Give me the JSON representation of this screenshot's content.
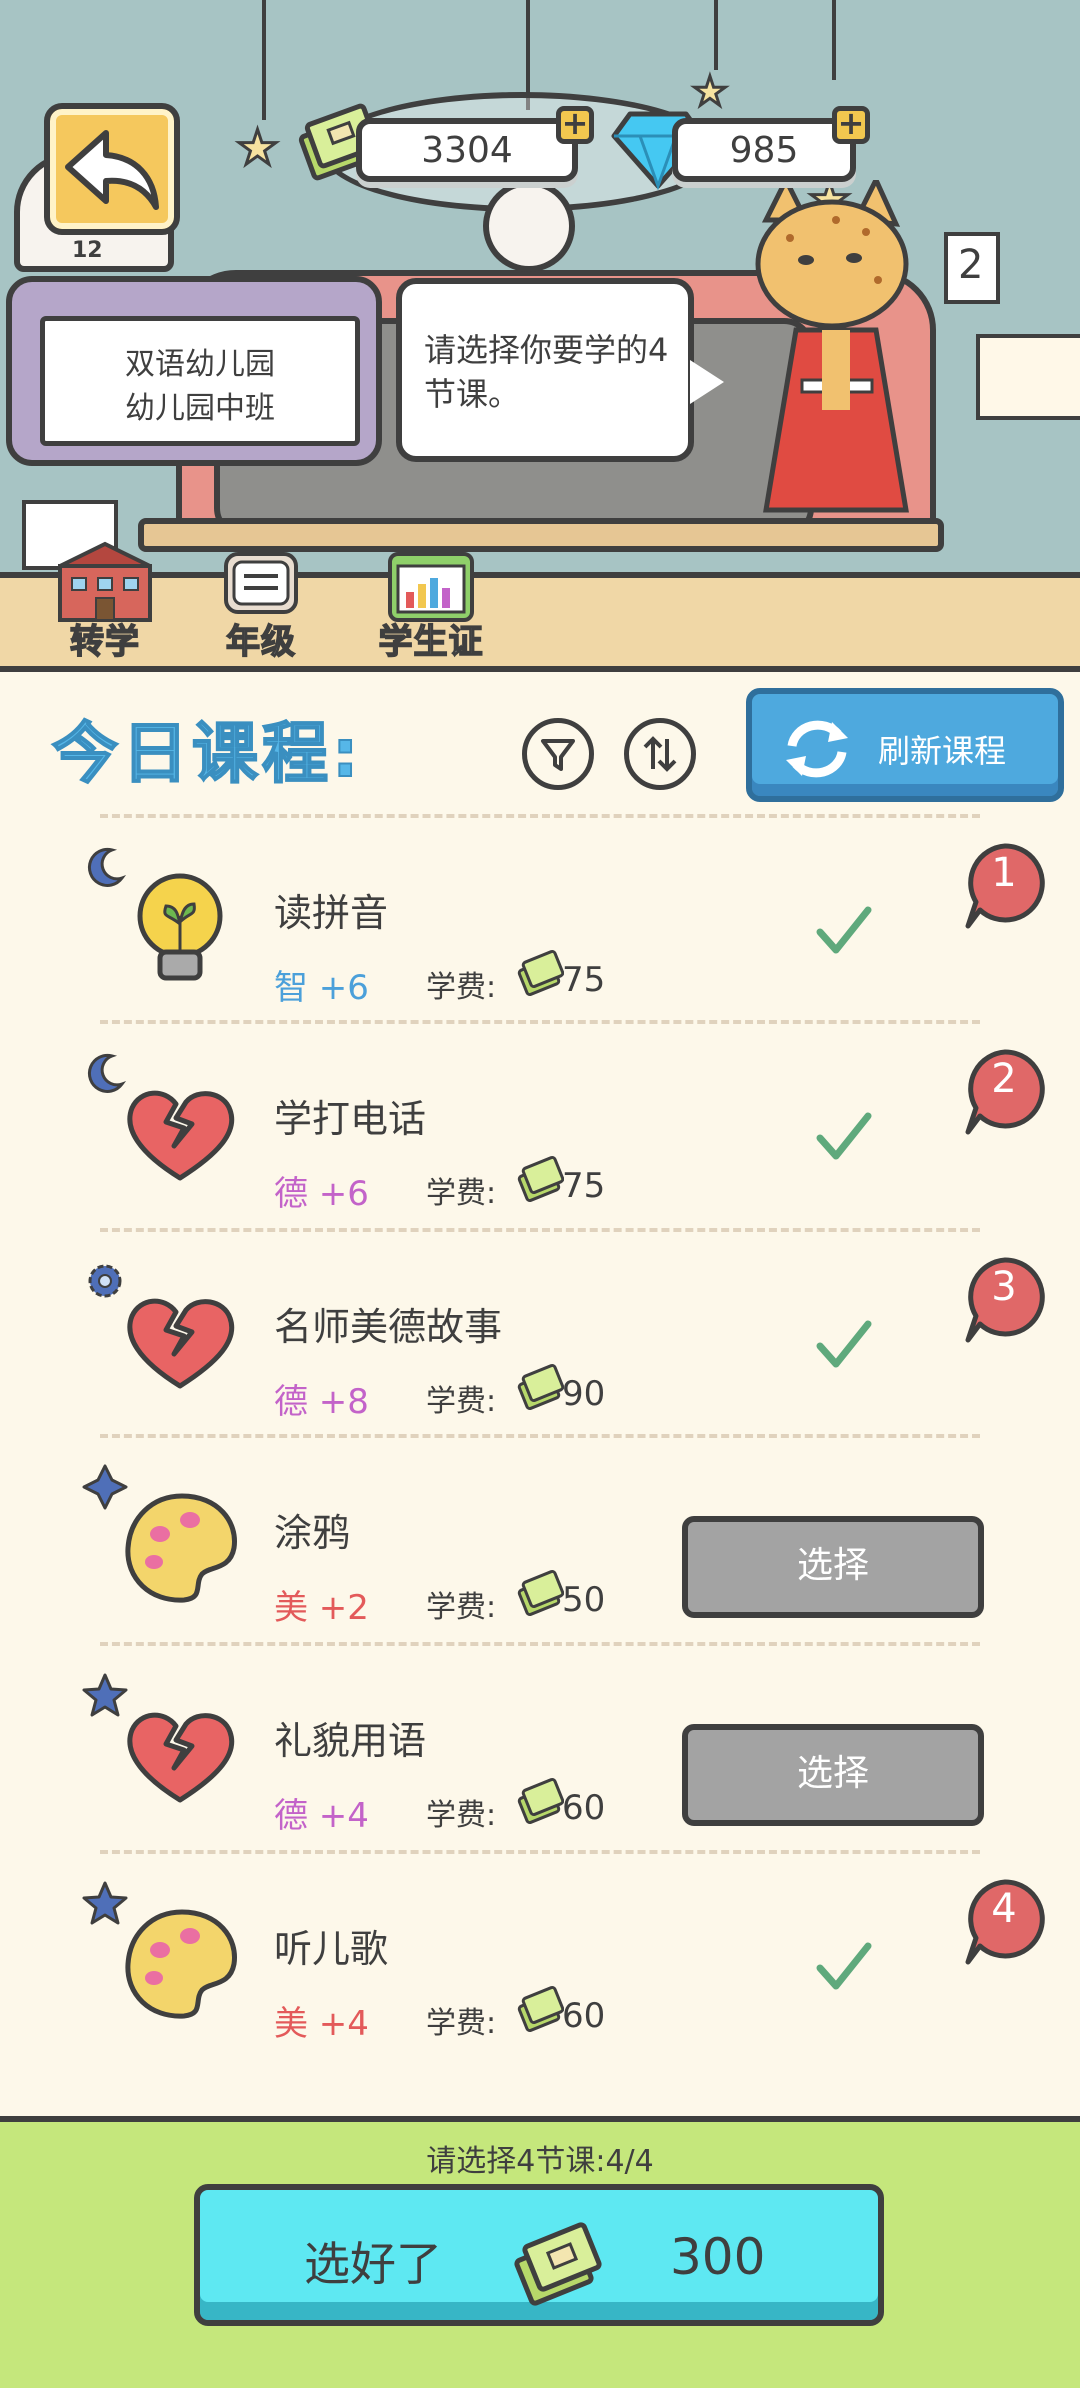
{
  "currency": {
    "money": "3304",
    "gems": "985"
  },
  "school": {
    "line1": "双语幼儿园",
    "line2": "幼儿园中班"
  },
  "bus_number": "12",
  "note_number": "2",
  "speech": "请选择你要学的4节课。",
  "shortcuts": [
    {
      "label": "转学",
      "icon": "school-building-icon"
    },
    {
      "label": "年级",
      "icon": "books-icon"
    },
    {
      "label": "学生证",
      "icon": "student-id-chart-icon"
    }
  ],
  "panel": {
    "title": "今日课程:",
    "refresh_label": "刷新课程"
  },
  "courses": [
    {
      "name": "读拼音",
      "stat": "智 +6",
      "fee_label": "学费:",
      "fee": "75",
      "badge": "moon-icon",
      "icon": "lightbulb-icon",
      "selected": true,
      "order": "1"
    },
    {
      "name": "学打电话",
      "stat": "德 +6",
      "fee_label": "学费:",
      "fee": "75",
      "badge": "moon-icon",
      "icon": "heart-icon",
      "selected": true,
      "order": "2"
    },
    {
      "name": "名师美德故事",
      "stat": "德 +8",
      "fee_label": "学费:",
      "fee": "90",
      "badge": "gear-icon",
      "icon": "heart-icon",
      "selected": true,
      "order": "3"
    },
    {
      "name": "涂鸦",
      "stat": "美 +2",
      "fee_label": "学费:",
      "fee": "50",
      "badge": "sparkle-icon",
      "icon": "palette-icon",
      "selected": false,
      "button": "选择"
    },
    {
      "name": "礼貌用语",
      "stat": "德 +4",
      "fee_label": "学费:",
      "fee": "60",
      "badge": "star-icon",
      "icon": "heart-icon",
      "selected": false,
      "button": "选择"
    },
    {
      "name": "听儿歌",
      "stat": "美 +4",
      "fee_label": "学费:",
      "fee": "60",
      "badge": "star-icon",
      "icon": "palette-icon",
      "selected": true,
      "order": "4"
    }
  ],
  "bottom": {
    "hint": "请选择4节课:4/4",
    "confirm_label": "选好了",
    "total_cost": "300"
  },
  "colors": {
    "accent_blue": "#4ea9de",
    "confirm_cyan": "#5ee8f2",
    "bottom_green": "#c5e77c",
    "order_red": "#e06868",
    "check_green": "#5fa97c"
  }
}
